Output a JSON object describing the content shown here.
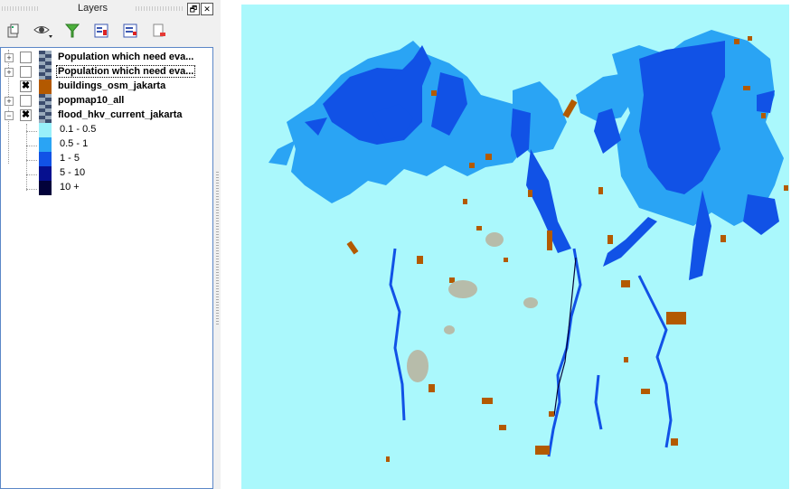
{
  "panel": {
    "title": "Layers",
    "float_glyph": "🗗",
    "close_glyph": "✕"
  },
  "toolbar": {
    "buttons": [
      {
        "name": "add-group-icon"
      },
      {
        "name": "visibility-icon"
      },
      {
        "name": "filter-icon"
      },
      {
        "name": "expand-all-icon"
      },
      {
        "name": "collapse-all-icon"
      },
      {
        "name": "remove-layer-icon"
      }
    ]
  },
  "layers": [
    {
      "name": "Population which need eva...",
      "checked": false,
      "expandable": true,
      "selected": false,
      "icon": "raster-icon"
    },
    {
      "name": "Population which need eva...",
      "checked": false,
      "expandable": true,
      "selected": true,
      "icon": "raster-icon"
    },
    {
      "name": "buildings_osm_jakarta",
      "checked": true,
      "expandable": false,
      "selected": false,
      "icon": "polygon-icon",
      "fill": "#b35900"
    },
    {
      "name": "popmap10_all",
      "checked": false,
      "expandable": true,
      "selected": false,
      "icon": "raster-icon"
    },
    {
      "name": "flood_hkv_current_jakarta",
      "checked": true,
      "expandable": true,
      "selected": false,
      "icon": "raster-icon",
      "expanded": true
    }
  ],
  "legend": [
    {
      "label": "0.1 - 0.5",
      "color": "#99f0fa"
    },
    {
      "label": "0.5 - 1",
      "color": "#2aa4f4"
    },
    {
      "label": "1 - 5",
      "color": "#1152e6"
    },
    {
      "label": "5 - 10",
      "color": "#06108f"
    },
    {
      "label": "10 +",
      "color": "#02023a"
    }
  ],
  "map": {
    "background": "#aaf8fc",
    "building_color": "#b35a00"
  }
}
